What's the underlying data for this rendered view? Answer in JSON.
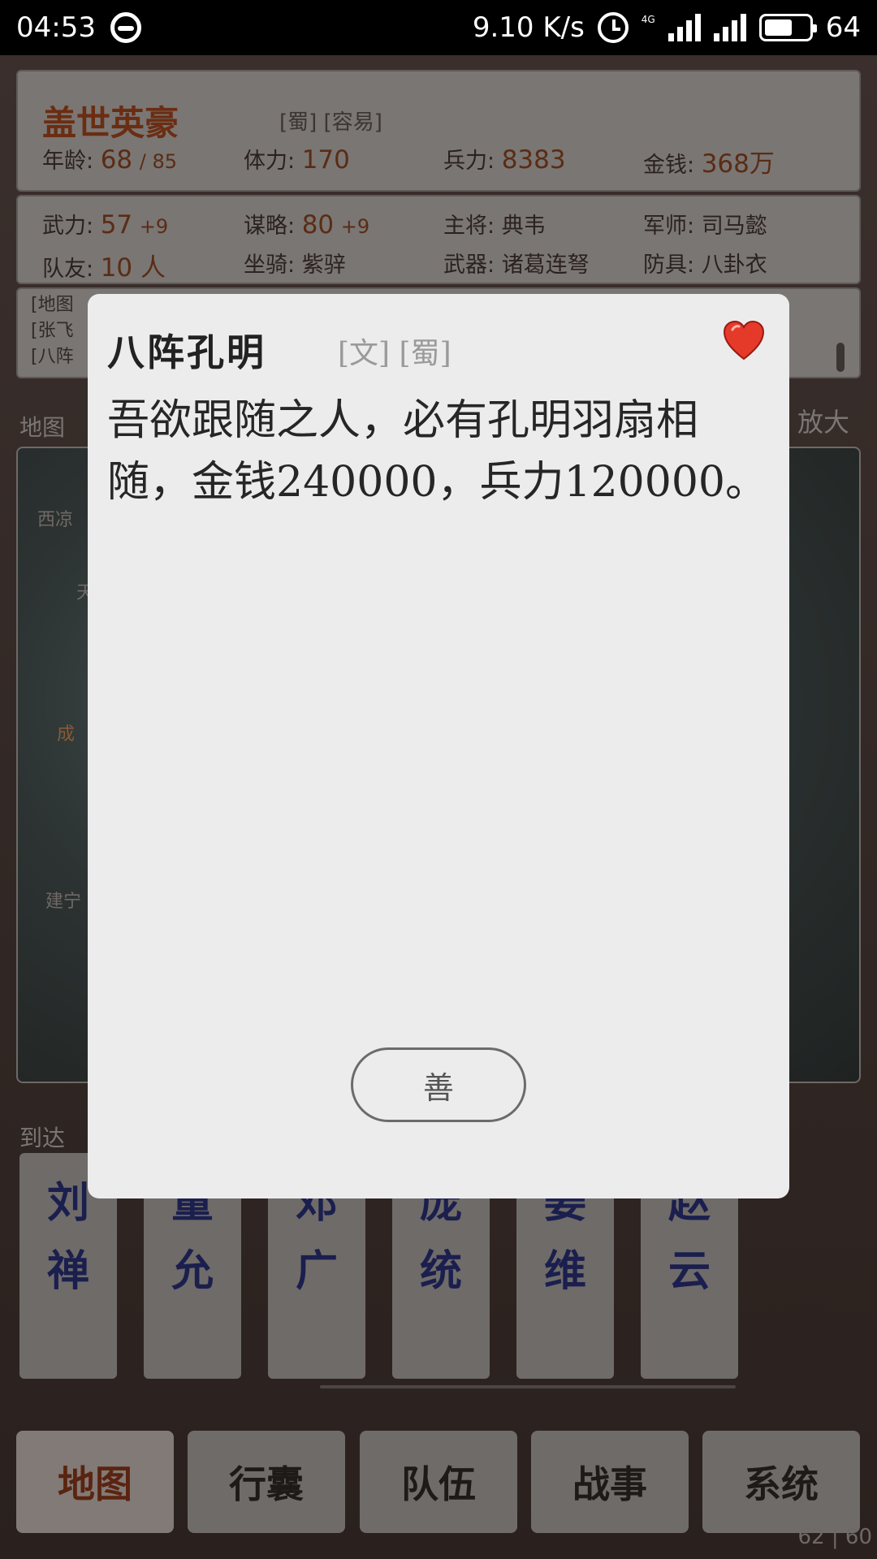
{
  "status_bar": {
    "time": "04:53",
    "net_speed": "9.10 K/s",
    "network_type": "4G",
    "battery": "64",
    "battery_fraction": 0.64
  },
  "hero": {
    "name": "盖世英豪",
    "tags": "[蜀] [容易]",
    "age_label": "年龄:",
    "age_value": "68",
    "age_max": "/ 85",
    "stamina_label": "体力:",
    "stamina_value": "170",
    "troops_label": "兵力:",
    "troops_value": "8383",
    "money_label": "金钱:",
    "money_value": "368万"
  },
  "attrs": {
    "force_label": "武力:",
    "force_value": "57",
    "force_bonus": "+9",
    "strategy_label": "谋略:",
    "strategy_value": "80",
    "strategy_bonus": "+9",
    "general_label": "主将:",
    "general_value": "典韦",
    "advisor_label": "军师:",
    "advisor_value": "司马懿",
    "team_label": "队友:",
    "team_value": "10 人",
    "mount_label": "坐骑:",
    "mount_value": "紫骍",
    "weapon_label": "武器:",
    "weapon_value": "诸葛连弩",
    "armor_label": "防具:",
    "armor_value": "八卦衣"
  },
  "log": {
    "lines": [
      "[地图",
      "[张飞",
      "[八阵"
    ]
  },
  "map": {
    "label": "地图",
    "zoom_label": "放大",
    "cities": [
      "西凉",
      "天",
      "成",
      "建宁"
    ]
  },
  "arrive": {
    "label": "到达",
    "characters": [
      {
        "top": "刘",
        "bottom": "禅"
      },
      {
        "top": "董",
        "bottom": "允"
      },
      {
        "top": "邓",
        "bottom": "广"
      },
      {
        "top": "庞",
        "bottom": "统"
      },
      {
        "top": "姜",
        "bottom": "维"
      },
      {
        "top": "赵",
        "bottom": "云"
      }
    ]
  },
  "nav": {
    "items": [
      "地图",
      "行囊",
      "队伍",
      "战事",
      "系统"
    ],
    "active": 0
  },
  "fps": "62 | 60",
  "modal": {
    "title": "八阵孔明",
    "tags": "[文] [蜀]",
    "message": "吾欲跟随之人，必有孔明羽扇相随，金钱240000，兵力120000。",
    "ok_label": "善",
    "heart_color": "#e53a2a"
  }
}
